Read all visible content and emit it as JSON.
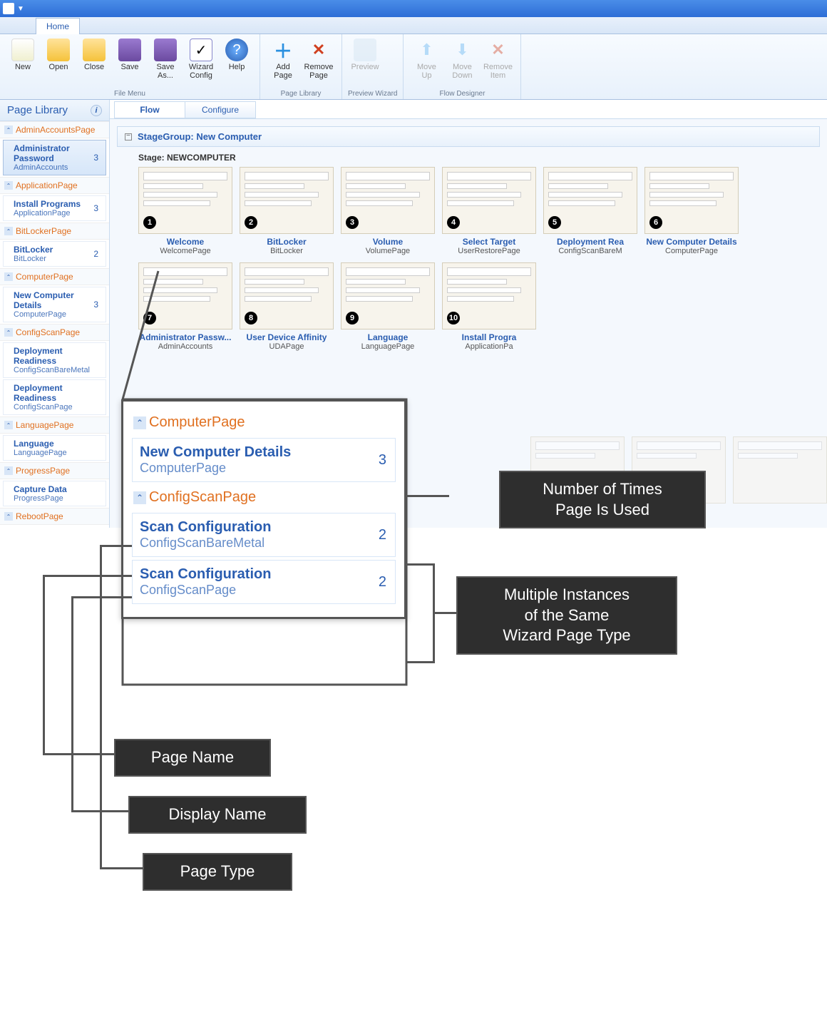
{
  "titlebar": {
    "home_tab": "Home"
  },
  "ribbon": {
    "groups": [
      {
        "label": "File Menu",
        "buttons": [
          {
            "name": "new",
            "label": "New",
            "icon": "new"
          },
          {
            "name": "open",
            "label": "Open",
            "icon": "folder"
          },
          {
            "name": "close",
            "label": "Close",
            "icon": "folder"
          },
          {
            "name": "save",
            "label": "Save",
            "icon": "save"
          },
          {
            "name": "saveas",
            "label": "Save As...",
            "icon": "save"
          },
          {
            "name": "wizcfg",
            "label": "Wizard Config",
            "icon": "wizard"
          },
          {
            "name": "help",
            "label": "Help",
            "icon": "help"
          }
        ]
      },
      {
        "label": "Page Library",
        "buttons": [
          {
            "name": "addpage",
            "label": "Add Page",
            "icon": "add"
          },
          {
            "name": "rmpage",
            "label": "Remove Page",
            "icon": "remove"
          }
        ]
      },
      {
        "label": "Preview Wizard",
        "buttons": [
          {
            "name": "preview",
            "label": "Preview",
            "icon": "preview",
            "disabled": true
          }
        ]
      },
      {
        "label": "Flow Designer",
        "buttons": [
          {
            "name": "moveup",
            "label": "Move Up",
            "icon": "up",
            "disabled": true
          },
          {
            "name": "movedn",
            "label": "Move Down",
            "icon": "down",
            "disabled": true
          },
          {
            "name": "rmitem",
            "label": "Remove Item",
            "icon": "remove",
            "disabled": true
          }
        ]
      }
    ]
  },
  "sidebar": {
    "title": "Page Library",
    "groups": [
      {
        "name": "AdminAccountsPage",
        "items": [
          {
            "display": "Administrator Password",
            "page": "AdminAccounts",
            "count": 3,
            "selected": true
          }
        ]
      },
      {
        "name": "ApplicationPage",
        "items": [
          {
            "display": "Install Programs",
            "page": "ApplicationPage",
            "count": 3
          }
        ]
      },
      {
        "name": "BitLockerPage",
        "items": [
          {
            "display": "BitLocker",
            "page": "BitLocker",
            "count": 2
          }
        ]
      },
      {
        "name": "ComputerPage",
        "items": [
          {
            "display": "New Computer Details",
            "page": "ComputerPage",
            "count": 3
          }
        ]
      },
      {
        "name": "ConfigScanPage",
        "items": [
          {
            "display": "Deployment Readiness",
            "page": "ConfigScanBareMetal",
            "count": ""
          },
          {
            "display": "Deployment Readiness",
            "page": "ConfigScanPage",
            "count": ""
          }
        ]
      },
      {
        "name": "LanguagePage",
        "items": [
          {
            "display": "Language",
            "page": "LanguagePage",
            "count": ""
          }
        ]
      },
      {
        "name": "ProgressPage",
        "items": [
          {
            "display": "Capture Data",
            "page": "ProgressPage",
            "count": ""
          }
        ]
      },
      {
        "name": "RebootPage",
        "items": []
      }
    ]
  },
  "content": {
    "subtabs": [
      "Flow",
      "Configure"
    ],
    "stagegroup": "StageGroup: New Computer",
    "stage": "Stage: NEWCOMPUTER",
    "thumbs": [
      {
        "n": 1,
        "display": "Welcome",
        "page": "WelcomePage"
      },
      {
        "n": 2,
        "display": "BitLocker",
        "page": "BitLocker"
      },
      {
        "n": 3,
        "display": "Volume",
        "page": "VolumePage"
      },
      {
        "n": 4,
        "display": "Select Target",
        "page": "UserRestorePage"
      },
      {
        "n": 5,
        "display": "Deployment Rea",
        "page": "ConfigScanBareM"
      },
      {
        "n": 6,
        "display": "New Computer Details",
        "page": "ComputerPage"
      },
      {
        "n": 7,
        "display": "Administrator Passw...",
        "page": "AdminAccounts"
      },
      {
        "n": 8,
        "display": "User Device Affinity",
        "page": "UDAPage"
      },
      {
        "n": 9,
        "display": "Language",
        "page": "LanguagePage"
      },
      {
        "n": 10,
        "display": "Install Progra",
        "page": "ApplicationPa"
      }
    ]
  },
  "callout": {
    "groups": [
      {
        "name": "ComputerPage",
        "items": [
          {
            "display": "New Computer Details",
            "page": "ComputerPage",
            "count": 3
          }
        ]
      },
      {
        "name": "ConfigScanPage",
        "items": [
          {
            "display": "Scan Configuration",
            "page": "ConfigScanBareMetal",
            "count": 2
          },
          {
            "display": "Scan Configuration",
            "page": "ConfigScanPage",
            "count": 2
          }
        ]
      }
    ]
  },
  "annotations": {
    "count": "Number of Times\nPage Is Used",
    "multi": "Multiple Instances\nof the Same\nWizard Page Type",
    "pagename": "Page Name",
    "displayname": "Display Name",
    "pagetype": "Page Type"
  }
}
